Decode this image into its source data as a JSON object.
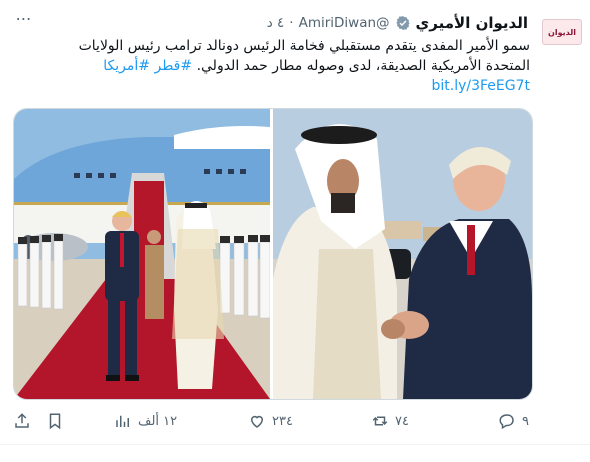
{
  "tweet": {
    "more_icon_label": "⋯",
    "avatar_text": "الديوان",
    "author_name": "الديوان الأميري",
    "handle": "@AmiriDiwan",
    "dot": "·",
    "time": "٤ د",
    "text_main": "سمو الأمير المفدى يتقدم مستقبلي فخامة الرئيس دونالد ترامب رئيس الولايات المتحدة الأمريكية الصديقة، لدى وصوله مطار حمد الدولي.",
    "hashtags": [
      "#قطر",
      "#أمريكا"
    ],
    "link": "bit.ly/3FeEG7t"
  },
  "actions": {
    "reply_count": "٩",
    "retweet_count": "٧٤",
    "like_count": "٢٣٤",
    "views_count": "١٢ ألف",
    "icons": [
      "reply-icon",
      "retweet-icon",
      "like-icon",
      "views-icon",
      "bookmark-icon",
      "share-icon"
    ]
  },
  "colors": {
    "accent": "#1d9bf0",
    "secondary_text": "#536471",
    "verified_badge": "#829aab",
    "carpet": "#b3162a",
    "sky": "#8fbce0"
  }
}
